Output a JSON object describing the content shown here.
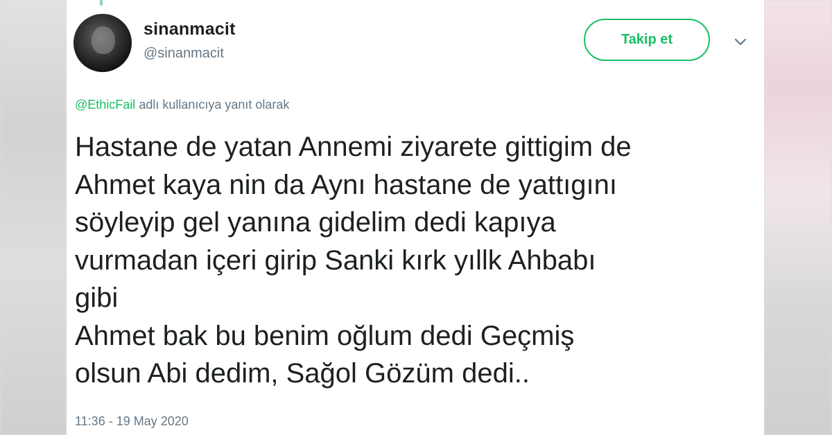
{
  "tweet": {
    "display_name": "sinanmacit",
    "handle": "@sinanmacit",
    "follow_label": "Takip et",
    "reply_mention": "@EthicFail",
    "reply_suffix": "adlı kullanıcıya yanıt olarak",
    "text": "Hastane de yatan Annemi ziyarete gittigim de\nAhmet kaya nin da Aynı hastane de yattıgını\nsöyleyip gel yanına gidelim dedi kapıya\nvurmadan içeri girip Sanki kırk yıllk Ahbabı\ngibi\nAhmet bak bu benim oğlum dedi Geçmiş\nolsun Abi dedim, Sağol Gözüm dedi..",
    "timestamp": "11:36 - 19 May 2020"
  },
  "icons": {
    "avatar": "profile-photo",
    "menu": "chevron-down-icon"
  },
  "colors": {
    "accent": "#17bf63",
    "text": "#1c2022",
    "secondary": "#657786"
  }
}
